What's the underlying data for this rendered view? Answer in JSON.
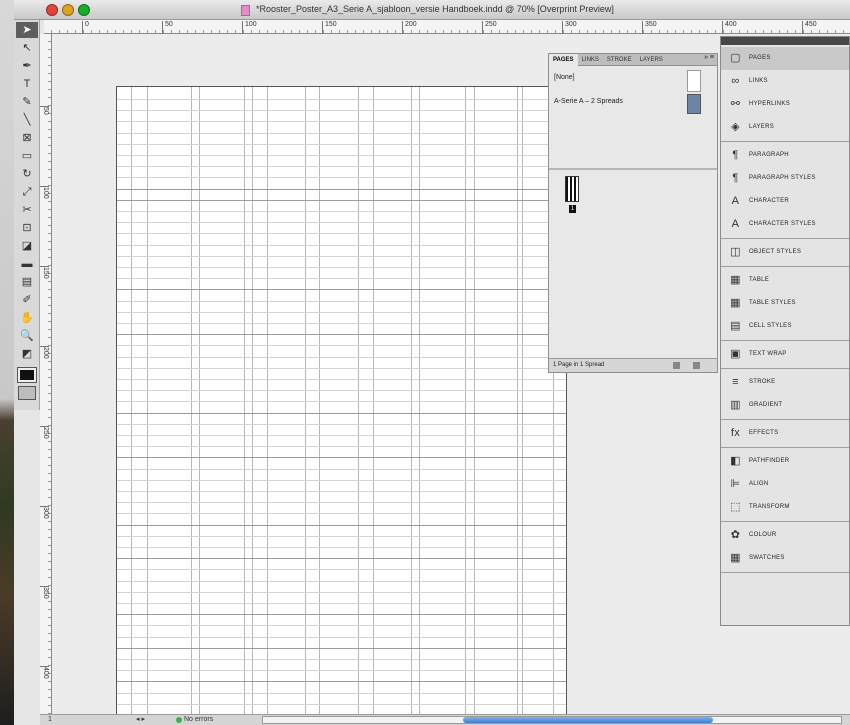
{
  "window": {
    "title": "*Rooster_Poster_A3_Serie A_sjabloon_versie Handboek.indd @ 70% [Overprint Preview]"
  },
  "rulers": {
    "top_labels": [
      "0",
      "50",
      "100",
      "150",
      "200",
      "250",
      "300",
      "350",
      "400",
      "450"
    ],
    "left_labels": [
      "50",
      "100",
      "150",
      "200",
      "250",
      "300",
      "350",
      "400"
    ]
  },
  "tools": [
    {
      "name": "selection-tool",
      "glyph": "➤"
    },
    {
      "name": "direct-selection-tool",
      "glyph": "↖"
    },
    {
      "name": "pen-tool",
      "glyph": "✒"
    },
    {
      "name": "type-tool",
      "glyph": "T"
    },
    {
      "name": "pencil-tool",
      "glyph": "✎"
    },
    {
      "name": "line-tool",
      "glyph": "╲"
    },
    {
      "name": "rectangle-frame-tool",
      "glyph": "⊠"
    },
    {
      "name": "rectangle-tool",
      "glyph": "▭"
    },
    {
      "name": "rotate-tool",
      "glyph": "↻"
    },
    {
      "name": "scale-tool",
      "glyph": "⤢"
    },
    {
      "name": "scissors-tool",
      "glyph": "✂"
    },
    {
      "name": "free-transform-tool",
      "glyph": "⊡"
    },
    {
      "name": "gradient-swatch-tool",
      "glyph": "◪"
    },
    {
      "name": "gradient-feather-tool",
      "glyph": "▬"
    },
    {
      "name": "note-tool",
      "glyph": "▤"
    },
    {
      "name": "eyedropper-tool",
      "glyph": "✐"
    },
    {
      "name": "hand-tool",
      "glyph": "✋"
    },
    {
      "name": "zoom-tool",
      "glyph": "🔍"
    },
    {
      "name": "fill-stroke-tool",
      "glyph": "◩"
    }
  ],
  "status": {
    "page": "1",
    "nav": "◂ ▸",
    "mode": "No errors",
    "mode_color": "#3cb043"
  },
  "pages_panel": {
    "tabs": [
      "PAGES",
      "LINKS",
      "STROKE",
      "LAYERS"
    ],
    "menu": "»  ≡",
    "master_none": "[None]",
    "master_a": "A-Serie A – 2 Spreads",
    "page_number": "1",
    "footer": "1 Page in 1 Spread"
  },
  "dock": {
    "groups": [
      [
        {
          "label": "PAGES",
          "icon": "▢",
          "icon_name": "pages-icon",
          "active": true
        },
        {
          "label": "LINKS",
          "icon": "∞",
          "icon_name": "links-icon"
        },
        {
          "label": "HYPERLINKS",
          "icon": "⚯",
          "icon_name": "hyperlinks-icon"
        },
        {
          "label": "LAYERS",
          "icon": "◈",
          "icon_name": "layers-icon"
        }
      ],
      [
        {
          "label": "PARAGRAPH",
          "icon": "¶",
          "icon_name": "paragraph-icon"
        },
        {
          "label": "PARAGRAPH STYLES",
          "icon": "¶",
          "icon_name": "paragraph-styles-icon"
        },
        {
          "label": "CHARACTER",
          "icon": "A",
          "icon_name": "character-icon"
        },
        {
          "label": "CHARACTER STYLES",
          "icon": "A",
          "icon_name": "character-styles-icon"
        }
      ],
      [
        {
          "label": "OBJECT STYLES",
          "icon": "◫",
          "icon_name": "object-styles-icon"
        }
      ],
      [
        {
          "label": "TABLE",
          "icon": "▦",
          "icon_name": "table-icon"
        },
        {
          "label": "TABLE STYLES",
          "icon": "▦",
          "icon_name": "table-styles-icon"
        },
        {
          "label": "CELL STYLES",
          "icon": "▤",
          "icon_name": "cell-styles-icon"
        }
      ],
      [
        {
          "label": "TEXT WRAP",
          "icon": "▣",
          "icon_name": "text-wrap-icon"
        }
      ],
      [
        {
          "label": "STROKE",
          "icon": "≡",
          "icon_name": "stroke-icon"
        },
        {
          "label": "GRADIENT",
          "icon": "▥",
          "icon_name": "gradient-icon"
        }
      ],
      [
        {
          "label": "EFFECTS",
          "icon": "fx",
          "icon_name": "effects-icon"
        }
      ],
      [
        {
          "label": "PATHFINDER",
          "icon": "◧",
          "icon_name": "pathfinder-icon"
        },
        {
          "label": "ALIGN",
          "icon": "⊫",
          "icon_name": "align-icon"
        },
        {
          "label": "TRANSFORM",
          "icon": "⬚",
          "icon_name": "transform-icon"
        }
      ],
      [
        {
          "label": "COLOUR",
          "icon": "✿",
          "icon_name": "colour-icon"
        },
        {
          "label": "SWATCHES",
          "icon": "▦",
          "icon_name": "swatches-icon"
        }
      ]
    ]
  }
}
